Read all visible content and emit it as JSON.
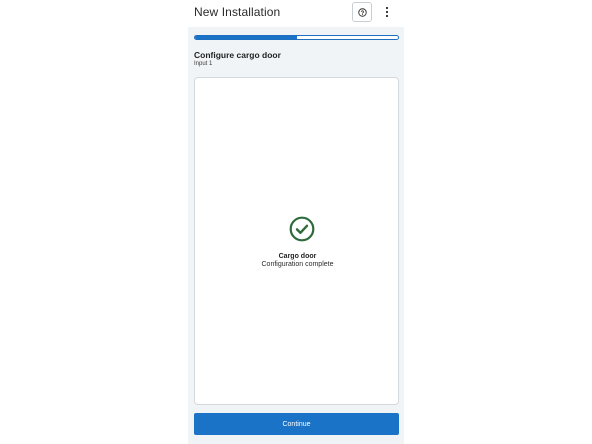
{
  "header": {
    "title": "New Installation",
    "help_icon": "help-circle-icon",
    "more_icon": "more-vert-icon"
  },
  "progress": {
    "value": 0.5
  },
  "step": {
    "title": "Configure cargo door",
    "subtitle": "Input 1"
  },
  "status": {
    "icon": "check-circle-icon",
    "title": "Cargo door",
    "message": "Configuration complete"
  },
  "actions": {
    "continue_label": "Continue"
  },
  "colors": {
    "accent": "#1a73c7",
    "success": "#2e6b3a",
    "background": "#f1f4f7"
  }
}
